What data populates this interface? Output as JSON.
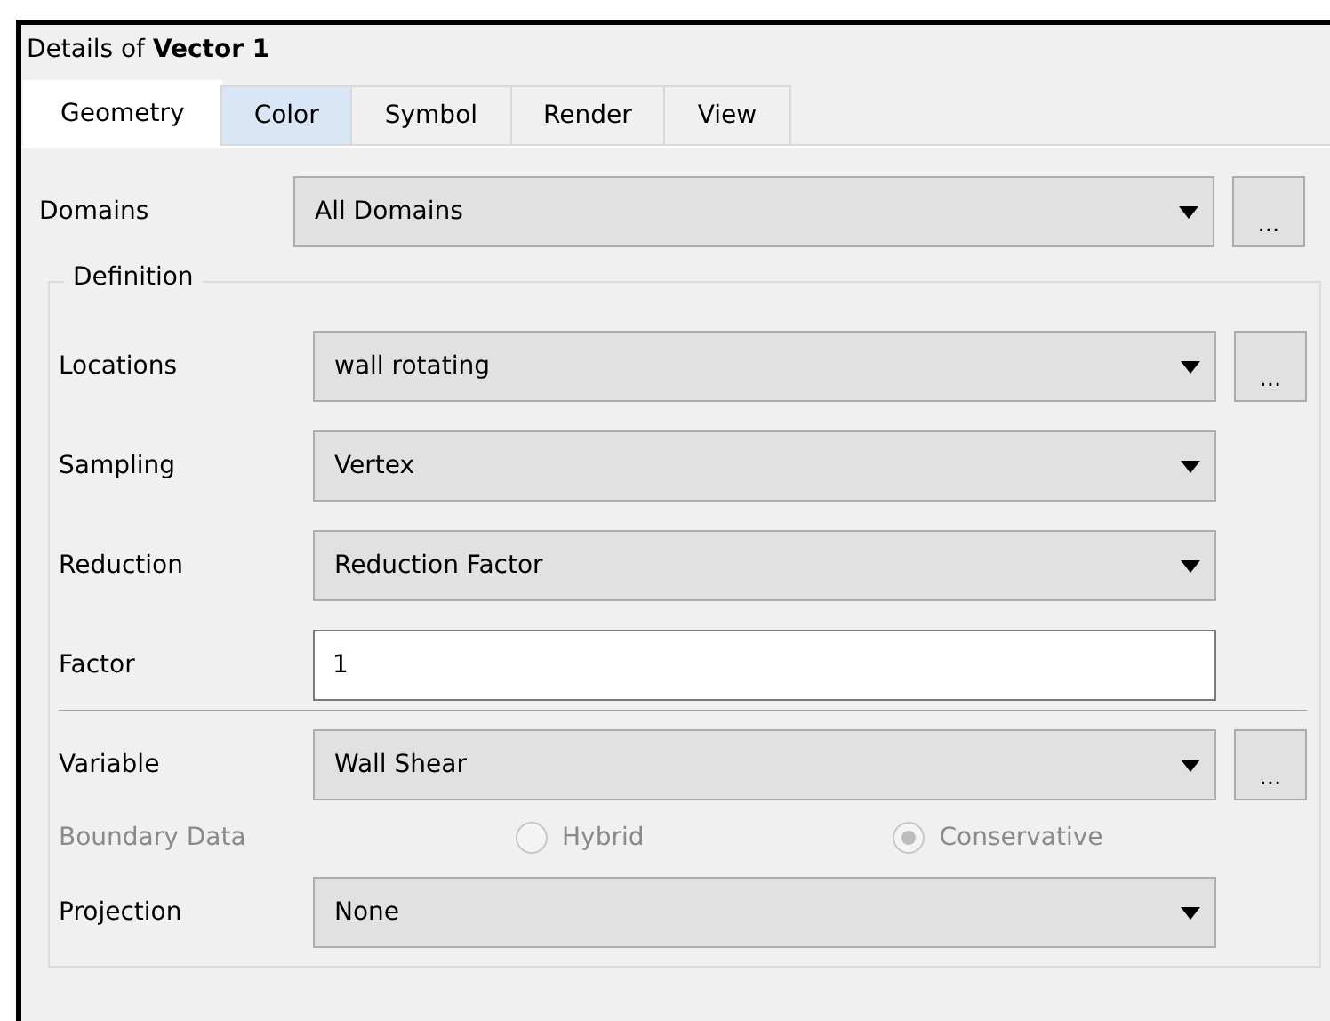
{
  "panel": {
    "title": "Details of **Vector 1**"
  },
  "tabs": [
    {
      "label": "Geometry",
      "selected": true,
      "hovered": false
    },
    {
      "label": "Color",
      "selected": false,
      "hovered": true
    },
    {
      "label": "Symbol",
      "selected": false,
      "hovered": false
    },
    {
      "label": "Render",
      "selected": false,
      "hovered": false
    },
    {
      "label": "View",
      "selected": false,
      "hovered": false
    }
  ],
  "domains": {
    "label": "Domains",
    "value": "All Domains",
    "more_button": "..."
  },
  "definition": {
    "title": "Definition",
    "rows": [
      {
        "kind": "combo",
        "label": "Locations",
        "value": "wall rotating",
        "more_button": "...",
        "divider_above": false,
        "disabled": false
      },
      {
        "kind": "combo",
        "label": "Sampling",
        "value": "Vertex",
        "divider_above": false,
        "disabled": false
      },
      {
        "kind": "combo",
        "label": "Reduction",
        "value": "Reduction Factor",
        "divider_above": false,
        "disabled": false
      },
      {
        "kind": "text",
        "label": "Factor",
        "value": "1",
        "divider_above": false,
        "disabled": false
      },
      {
        "kind": "combo",
        "label": "Variable",
        "value": "Wall Shear",
        "more_button": "...",
        "divider_above": true,
        "disabled": false
      },
      {
        "kind": "radio",
        "label": "Boundary Data",
        "divider_above": false,
        "disabled": true,
        "options": [
          {
            "label": "Hybrid",
            "selected": false
          },
          {
            "label": "Conservative",
            "selected": true
          }
        ]
      },
      {
        "kind": "combo",
        "label": "Projection",
        "value": "None",
        "divider_above": false,
        "disabled": false
      }
    ]
  }
}
